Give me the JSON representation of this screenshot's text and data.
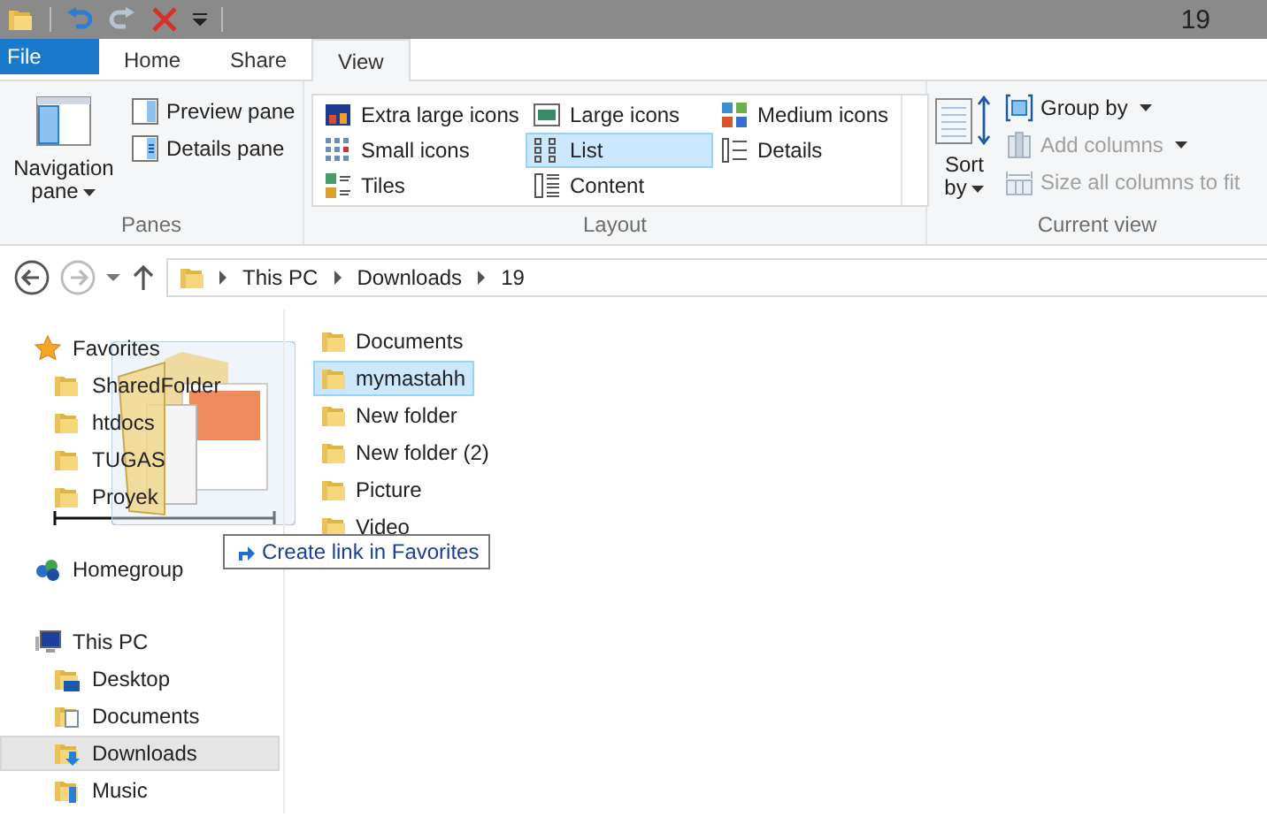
{
  "window": {
    "title": "19"
  },
  "tabs": [
    {
      "label": "File",
      "kind": "file",
      "selected": false
    },
    {
      "label": "Home",
      "kind": "tab",
      "selected": false
    },
    {
      "label": "Share",
      "kind": "tab",
      "selected": false
    },
    {
      "label": "View",
      "kind": "tab",
      "selected": true
    }
  ],
  "ribbon": {
    "panes": {
      "title": "Panes",
      "navigation_pane": "Navigation pane",
      "items": [
        {
          "label": "Preview pane",
          "kind": "preview"
        },
        {
          "label": "Details pane",
          "kind": "details"
        }
      ]
    },
    "layout": {
      "title": "Layout",
      "options": [
        {
          "label": "Extra large icons",
          "kind": "xl",
          "selected": false
        },
        {
          "label": "Large icons",
          "kind": "large",
          "selected": false
        },
        {
          "label": "Medium icons",
          "kind": "medium",
          "selected": false
        },
        {
          "label": "Small icons",
          "kind": "small",
          "selected": false
        },
        {
          "label": "List",
          "kind": "list",
          "selected": true
        },
        {
          "label": "Details",
          "kind": "details",
          "selected": false
        },
        {
          "label": "Tiles",
          "kind": "tiles",
          "selected": false
        },
        {
          "label": "Content",
          "kind": "content",
          "selected": false
        }
      ]
    },
    "current_view": {
      "title": "Current view",
      "sort_by": "Sort by",
      "items": [
        {
          "label": "Group by",
          "kind": "group",
          "disabled": false
        },
        {
          "label": "Add columns",
          "kind": "columns",
          "disabled": true
        },
        {
          "label": "Size all columns to fit",
          "kind": "fit",
          "disabled": true
        }
      ]
    }
  },
  "address": {
    "forward_disabled": true,
    "path": [
      "This PC",
      "Downloads",
      "19"
    ]
  },
  "nav_pane": [
    {
      "label": "Favorites",
      "kind": "favorites",
      "selected": false,
      "children": [
        {
          "label": "SharedFolder",
          "kind": "folder",
          "selected": false
        },
        {
          "label": "htdocs",
          "kind": "folder",
          "selected": false
        },
        {
          "label": "TUGAS",
          "kind": "folder",
          "selected": false
        },
        {
          "label": "Proyek",
          "kind": "folder",
          "selected": false
        }
      ]
    },
    {
      "label": "Homegroup",
      "kind": "homegroup",
      "selected": false
    },
    {
      "label": "This PC",
      "kind": "pc",
      "selected": false,
      "children": [
        {
          "label": "Desktop",
          "kind": "desktop",
          "selected": false
        },
        {
          "label": "Documents",
          "kind": "documents",
          "selected": false
        },
        {
          "label": "Downloads",
          "kind": "downloads",
          "selected": true
        },
        {
          "label": "Music",
          "kind": "music",
          "selected": false
        }
      ]
    }
  ],
  "files": [
    {
      "name": "Documents",
      "selected": false
    },
    {
      "name": "mymastahh",
      "selected": true
    },
    {
      "name": "New folder",
      "selected": false
    },
    {
      "name": "New folder (2)",
      "selected": false
    },
    {
      "name": "Picture",
      "selected": false
    },
    {
      "name": "Video",
      "selected": false
    }
  ],
  "drag": {
    "tooltip": "Create link in Favorites"
  }
}
